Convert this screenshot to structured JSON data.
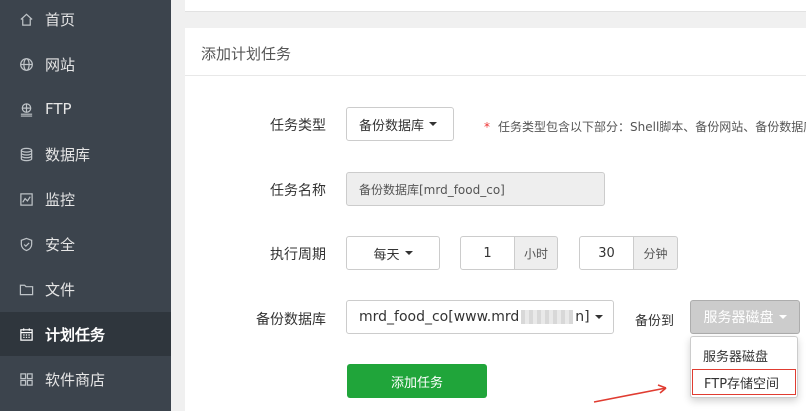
{
  "sidebar": {
    "items": [
      {
        "label": "首页",
        "icon": "home-icon"
      },
      {
        "label": "网站",
        "icon": "globe-icon"
      },
      {
        "label": "FTP",
        "icon": "ftp-icon"
      },
      {
        "label": "数据库",
        "icon": "database-icon"
      },
      {
        "label": "监控",
        "icon": "monitor-icon"
      },
      {
        "label": "安全",
        "icon": "shield-icon"
      },
      {
        "label": "文件",
        "icon": "folder-icon"
      },
      {
        "label": "计划任务",
        "icon": "calendar-icon",
        "active": true
      },
      {
        "label": "软件商店",
        "icon": "grid-icon"
      }
    ]
  },
  "card": {
    "title": "添加计划任务"
  },
  "form": {
    "task_type_label": "任务类型",
    "task_type_value": "备份数据库",
    "task_type_hint_star": "*",
    "task_type_hint": "任务类型包含以下部分：Shell脚本、备份网站、备份数据库",
    "task_name_label": "任务名称",
    "task_name_value": "备份数据库[mrd_food_co]",
    "period_label": "执行周期",
    "period_value": "每天",
    "hour_value": "1",
    "hour_unit": "小时",
    "minute_value": "30",
    "minute_unit": "分钟",
    "backup_db_label": "备份数据库",
    "backup_db_value_prefix": "mrd_food_co[www.mrd",
    "backup_db_value_suffix": "n]",
    "backup_to_label": "备份到",
    "storage_selected": "服务器磁盘",
    "storage_options": [
      "服务器磁盘",
      "FTP存储空间"
    ],
    "submit_label": "添加任务"
  },
  "colors": {
    "sidebar_bg": "#3c444d",
    "sidebar_active_bg": "#2f363d",
    "primary_green": "#20a53a",
    "highlight_red": "#e03c31"
  }
}
